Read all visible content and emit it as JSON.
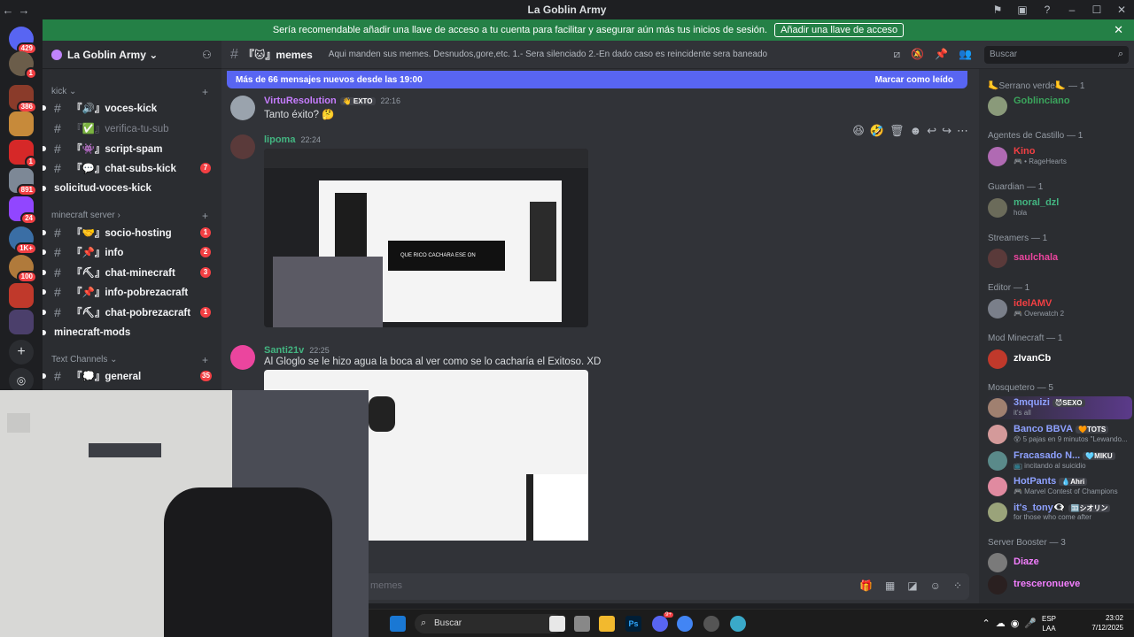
{
  "window": {
    "title": "La Goblin Army",
    "back": "←",
    "forward": "→"
  },
  "banner": {
    "text": "Sería recomendable añadir una llave de acceso a tu cuenta para facilitar y asegurar aún más tus inicios de sesión.",
    "button": "Añadir una llave de acceso",
    "close": "✕"
  },
  "servers": [
    {
      "badge": "429"
    },
    {
      "badge": "1"
    },
    {
      "badge": "386"
    },
    {
      "badge": ""
    },
    {
      "badge": "1"
    },
    {
      "badge": "891"
    },
    {
      "badge": "24"
    },
    {
      "badge": "1K+"
    },
    {
      "badge": "100"
    },
    {
      "badge": ""
    },
    {
      "badge": ""
    }
  ],
  "sidebar": {
    "guild_name": "La Goblin Army ⌄",
    "categories": {
      "kick": "kick ⌄",
      "minecraft": "minecraft server ›",
      "text": "Text Channels ⌄"
    },
    "plus": "+",
    "channels": [
      {
        "name": "『🔊』voces-kick",
        "badge": ""
      },
      {
        "name": "『✅』verifica-tu-sub",
        "badge": ""
      },
      {
        "name": "『👾』script-spam",
        "badge": ""
      },
      {
        "name": "『💬』chat-subs-kick",
        "badge": "7"
      },
      {
        "name": "solicitud-voces-kick",
        "badge": ""
      },
      {
        "name": "『🤝』socio-hosting",
        "badge": "1"
      },
      {
        "name": "『📌』info",
        "badge": "2"
      },
      {
        "name": "『⛏』chat-minecraft",
        "badge": "3"
      },
      {
        "name": "『📌』info-pobrezacraft",
        "badge": ""
      },
      {
        "name": "『⛏』chat-pobrezacraft",
        "badge": "1"
      },
      {
        "name": "minecraft-mods",
        "badge": ""
      },
      {
        "name": "『💭』general",
        "badge": "35"
      }
    ]
  },
  "chat": {
    "channel": "『🐱』memes",
    "topic": "Aqui manden sus memes. Desnudos,gore,etc. 1.- Sera silenciado 2.-En dado caso es reincidente sera baneado",
    "search_placeholder": "Buscar",
    "new_messages": "Más de 66 mensajes nuevos desde las 19:00",
    "mark_read": "Marcar como leído",
    "messages": [
      {
        "author": "VirtuResolution",
        "tag": "👋 EXTO",
        "time": "22:16",
        "text": "Tanto éxito? 🤔"
      },
      {
        "author": "lipoma",
        "tag": "",
        "time": "22:24",
        "text": ""
      },
      {
        "author": "Santi21v",
        "tag": "",
        "time": "22:25",
        "text": "Al Gloglo se le hizo agua la boca al ver como se lo cacharía el Exitoso. XD"
      }
    ],
    "image_overlay_text": "QUE RICO CACHARA ESE ON",
    "reactions": [
      "😆",
      "🤣",
      "🗑",
      "☻",
      "↩",
      "↪",
      "⋯"
    ],
    "composer_placeholder": "memes"
  },
  "members": {
    "groups": [
      {
        "title": "🦶Serrano verde🦶 — 1",
        "members": [
          {
            "name": "Goblinciano",
            "sub": "",
            "color": "#3ba55c",
            "tag": ""
          }
        ]
      },
      {
        "title": "Agentes de Castillo — 1",
        "members": [
          {
            "name": "Kino",
            "sub": "🎮 • RageHearts",
            "color": "#f23f43",
            "tag": ""
          }
        ]
      },
      {
        "title": "Guardian — 1",
        "members": [
          {
            "name": "moral_dzl",
            "sub": "hola",
            "color": "#43b581",
            "tag": ""
          }
        ]
      },
      {
        "title": "Streamers — 1",
        "members": [
          {
            "name": "saulchala",
            "sub": "",
            "color": "#eb459e",
            "tag": ""
          }
        ]
      },
      {
        "title": "Editor — 1",
        "members": [
          {
            "name": "idelAMV",
            "sub": "🎮 Overwatch 2",
            "color": "#f23f43",
            "tag": ""
          }
        ]
      },
      {
        "title": "Mod Minecraft — 1",
        "members": [
          {
            "name": "zIvanCb",
            "sub": "",
            "color": "#ffffff",
            "tag": ""
          }
        ]
      },
      {
        "title": "Mosquetero — 5",
        "members": [
          {
            "name": "3mquizi",
            "sub": "it's all",
            "color": "#5865f2",
            "tag": "😈SEXO"
          },
          {
            "name": "Banco BBVA",
            "sub": "😵 5 pajas en 9 minutos \"Lewando...",
            "color": "#5865f2",
            "tag": "🧡TOTS"
          },
          {
            "name": "Fracasado N...",
            "sub": "📺 incitando al suicidio",
            "color": "#5865f2",
            "tag": "🩵MIKU"
          },
          {
            "name": "HotPants",
            "sub": "🎮 Marvel Contest of Champions",
            "color": "#5865f2",
            "tag": "💧Ahri"
          },
          {
            "name": "it's_tony👁‍🗨",
            "sub": "for those who come after",
            "color": "#5865f2",
            "tag": "🈁シオリン"
          }
        ]
      },
      {
        "title": "Server Booster — 3",
        "members": [
          {
            "name": "Diaze",
            "sub": "",
            "color": "#f47fff",
            "tag": ""
          },
          {
            "name": "tresceronueve",
            "sub": "",
            "color": "#f47fff",
            "tag": ""
          }
        ]
      }
    ]
  },
  "taskbar": {
    "search": "Buscar",
    "lang_top": "ESP",
    "lang_bottom": "LAA",
    "time": "23:02",
    "date": "7/12/2025",
    "notif_badge": "9+"
  },
  "colors": {
    "accent": "#5865f2",
    "banner": "#248046",
    "badge": "#f23f43"
  }
}
